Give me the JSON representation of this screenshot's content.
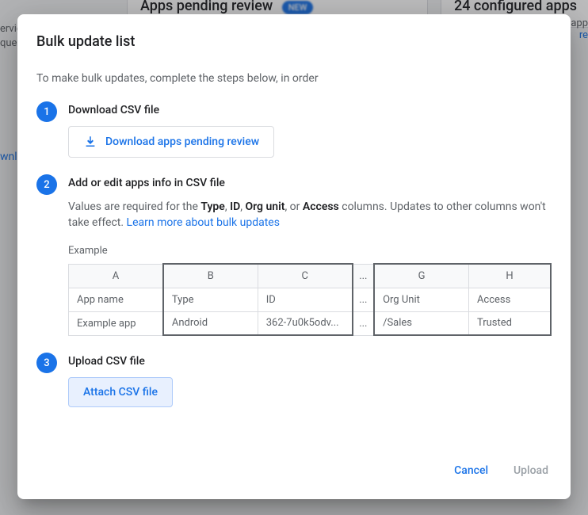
{
  "background": {
    "card1_title": "Apps pending review",
    "card2_title": "24 configured apps",
    "left_text1": "ervic",
    "left_text2": "que",
    "left_link": "wnl",
    "right_text1": "app",
    "right_link": "re"
  },
  "dialog": {
    "title": "Bulk update list",
    "intro": "To make bulk updates, complete the steps below, in order",
    "step1": {
      "num": "1",
      "title": "Download CSV file",
      "button": "Download apps pending review"
    },
    "step2": {
      "num": "2",
      "title": "Add or edit apps info in CSV file",
      "desc_prefix": "Values are required for the ",
      "col_type": "Type",
      "sep1": ", ",
      "col_id": "ID",
      "sep2": ", ",
      "col_org": "Org unit",
      "sep3": ", or ",
      "col_access": "Access",
      "desc_suffix": " columns. Updates to other columns won't take effect. ",
      "learn_more": "Learn more about bulk updates",
      "example_label": "Example",
      "table": {
        "headers": {
          "a": "A",
          "b": "B",
          "c": "C",
          "dots": "...",
          "g": "G",
          "h": "H"
        },
        "row1": {
          "a": "App name",
          "b": "Type",
          "c": "ID",
          "dots": "...",
          "g": "Org Unit",
          "h": "Access"
        },
        "row2": {
          "a": "Example app",
          "b": "Android",
          "c": "362-7u0k5odv...",
          "dots": "...",
          "g": "/Sales",
          "h": "Trusted"
        }
      }
    },
    "step3": {
      "num": "3",
      "title": "Upload CSV file",
      "button": "Attach CSV file"
    },
    "actions": {
      "cancel": "Cancel",
      "upload": "Upload"
    }
  }
}
